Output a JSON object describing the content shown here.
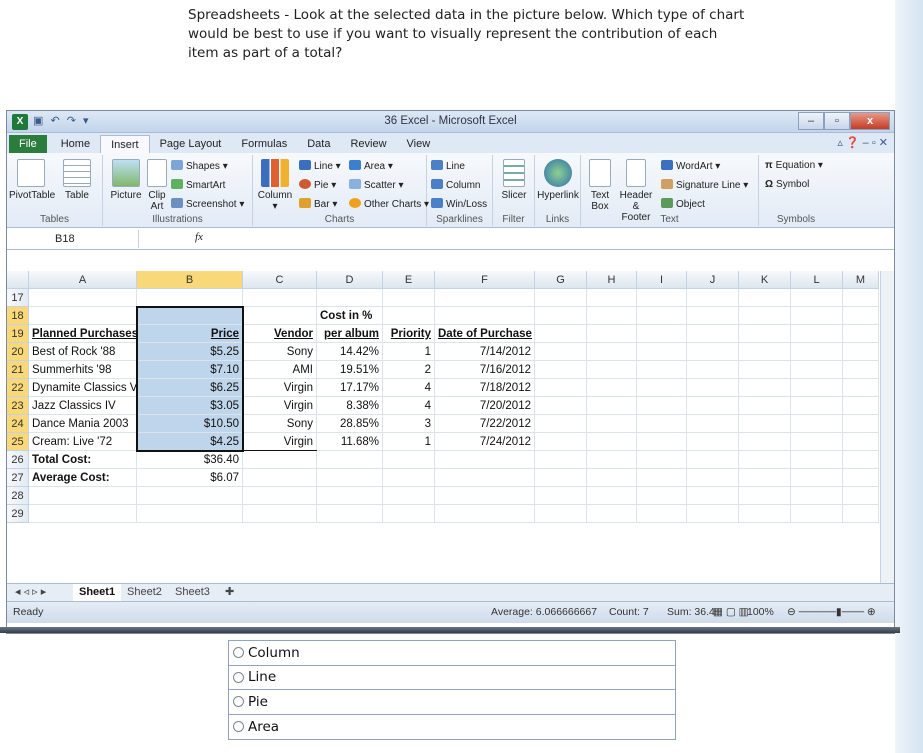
{
  "question": "Spreadsheets - Look at the selected data in the picture below. Which type of chart would be best to use if you want to visually represent the contribution of each item as part of a total?",
  "window": {
    "title": "36 Excel - Microsoft Excel"
  },
  "tabs": [
    "File",
    "Home",
    "Insert",
    "Page Layout",
    "Formulas",
    "Data",
    "Review",
    "View"
  ],
  "active_tab": "Insert",
  "ribbon": {
    "tables": {
      "label": "Tables",
      "pivot": "PivotTable",
      "table": "Table"
    },
    "illustrations": {
      "label": "Illustrations",
      "picture": "Picture",
      "clipart": "Clip Art",
      "shapes": "Shapes",
      "smartart": "SmartArt",
      "screenshot": "Screenshot"
    },
    "charts": {
      "label": "Charts",
      "column": "Column",
      "line": "Line",
      "pie": "Pie",
      "bar": "Bar",
      "area": "Area",
      "scatter": "Scatter",
      "other": "Other Charts"
    },
    "sparklines": {
      "label": "Sparklines",
      "line": "Line",
      "column": "Column",
      "winloss": "Win/Loss"
    },
    "filter": {
      "label": "Filter",
      "slicer": "Slicer"
    },
    "links": {
      "label": "Links",
      "hyperlink": "Hyperlink"
    },
    "text": {
      "label": "Text",
      "textbox": "Text Box",
      "header": "Header & Footer",
      "wordart": "WordArt",
      "sigline": "Signature Line",
      "object": "Object"
    },
    "symbols": {
      "label": "Symbols",
      "equation": "Equation",
      "symbol": "Symbol"
    }
  },
  "namebox": "B18",
  "columns": [
    "A",
    "B",
    "C",
    "D",
    "E",
    "F",
    "G",
    "H",
    "I",
    "J",
    "K",
    "L",
    "M"
  ],
  "rows": [
    "17",
    "18",
    "19",
    "20",
    "21",
    "22",
    "23",
    "24",
    "25",
    "26",
    "27",
    "28",
    "29"
  ],
  "cells": {
    "d18": "Cost in %",
    "headers": {
      "a": "Planned Purchases",
      "b": "Price",
      "c": "Vendor",
      "d": "per album",
      "e": "Priority",
      "f": "Date of Purchase"
    },
    "data": [
      {
        "a": "Best of Rock '88",
        "b": "$5.25",
        "c": "Sony",
        "d": "14.42%",
        "e": "1",
        "f": "7/14/2012"
      },
      {
        "a": "Summerhits '98",
        "b": "$7.10",
        "c": "AMI",
        "d": "19.51%",
        "e": "2",
        "f": "7/16/2012"
      },
      {
        "a": "Dynamite Classics V",
        "b": "$6.25",
        "c": "Virgin",
        "d": "17.17%",
        "e": "4",
        "f": "7/18/2012"
      },
      {
        "a": "Jazz Classics IV",
        "b": "$3.05",
        "c": "Virgin",
        "d": "8.38%",
        "e": "4",
        "f": "7/20/2012"
      },
      {
        "a": "Dance Mania 2003",
        "b": "$10.50",
        "c": "Sony",
        "d": "28.85%",
        "e": "3",
        "f": "7/22/2012"
      },
      {
        "a": "Cream: Live '72",
        "b": "$4.25",
        "c": "Virgin",
        "d": "11.68%",
        "e": "1",
        "f": "7/24/2012"
      }
    ],
    "total_label": "Total Cost:",
    "total_value": "$36.40",
    "avg_label": "Average Cost:",
    "avg_value": "$6.07"
  },
  "sheets": [
    "Sheet1",
    "Sheet2",
    "Sheet3"
  ],
  "status": {
    "ready": "Ready",
    "average": "Average: 6.066666667",
    "count": "Count: 7",
    "sum": "Sum: 36.4",
    "zoom": "100%"
  },
  "answers": [
    "Column",
    "Line",
    "Pie",
    "Area"
  ]
}
